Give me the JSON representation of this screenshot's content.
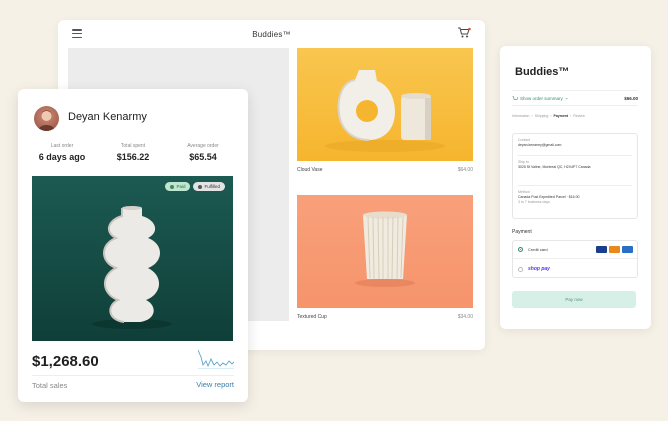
{
  "storefront": {
    "title": "Buddies™",
    "products": [
      {
        "name": "Cloud Vase",
        "price": "$64.00"
      },
      {
        "name": "Textured Cup",
        "price": "$34.00"
      }
    ]
  },
  "checkout": {
    "brand": "Buddies™",
    "summary_link": "Show order summary",
    "summary_amount": "$66.00",
    "breadcrumbs": [
      "Information",
      "Shipping",
      "Payment",
      "Review"
    ],
    "active_step": "Payment",
    "contact_label": "Contact",
    "contact_value": "deyan.kenarmy@gmail.com",
    "ship_to_label": "Ship to",
    "ship_to_value": "3025 St Valine, Montreal QC, H2X4P7 Canada",
    "method_label": "Method",
    "method_value": "Canada Post Expedited Parcel · $16.00",
    "method_note": "3 to 7 business days",
    "payment_title": "Payment",
    "pay_option_card": "Credit card",
    "pay_option_shoppay": "shop pay",
    "pay_button": "Pay now"
  },
  "customer": {
    "name": "Deyan Kenarmy",
    "stats": [
      {
        "label": "Last order",
        "value": "6 days ago"
      },
      {
        "label": "Total spent",
        "value": "$156.22"
      },
      {
        "label": "Average order",
        "value": "$65.54"
      }
    ],
    "badges": {
      "paid": "Paid",
      "fulfilled": "Fulfilled"
    },
    "total_sales": "$1,268.60",
    "total_sales_label": "Total sales",
    "report_link": "View report"
  },
  "colors": {
    "page_bg": "#f6f1e7",
    "accent_green": "#3a8a78",
    "link_blue": "#3d7ea6",
    "yellow_tile": "#f9c64f",
    "salmon_tile": "#f8a07a",
    "teal_image": "#1c5a52"
  },
  "icons": {
    "menu": "hamburger-icon",
    "cart": "cart-icon",
    "sparkline": "sparkline-chart"
  }
}
